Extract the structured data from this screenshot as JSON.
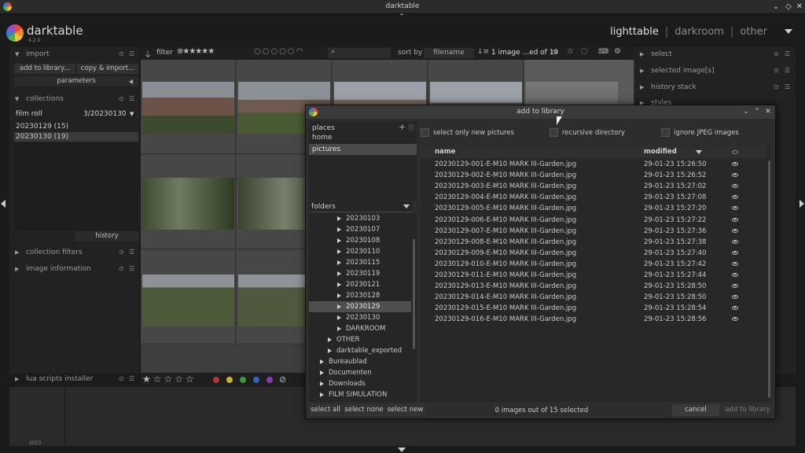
{
  "window": {
    "title": "darktable"
  },
  "header": {
    "app_name": "darktable",
    "version": "4.2.0",
    "views": [
      "lighttable",
      "darkroom",
      "other"
    ],
    "view_separator": "|"
  },
  "left_panel": {
    "import": {
      "label": "import",
      "add_button": "add to library...",
      "copy_button": "copy & import...",
      "parameters": "parameters"
    },
    "collections": {
      "label": "collections",
      "field": "film roll",
      "value": "3/20230130",
      "items": [
        "20230129 (15)",
        "20230130 (19)"
      ],
      "history": "history"
    },
    "collection_filters": "collection filters",
    "image_information": "image information",
    "lua_scripts": "lua scripts installer"
  },
  "filter_bar": {
    "filter_label": "filter",
    "sort_label": "sort by",
    "sort_value": "filename",
    "count_label": "1 image ...ed of 19"
  },
  "filmstrip": {
    "year": "2023"
  },
  "right_panel": {
    "sections": [
      "select",
      "selected image[s]",
      "history stack",
      "styles"
    ]
  },
  "dialog": {
    "title": "add to library",
    "places_label": "places",
    "places": [
      "home",
      "pictures"
    ],
    "folders_label": "folders",
    "folders": [
      {
        "name": "20230103",
        "level": 2,
        "expander": true
      },
      {
        "name": "20230107",
        "level": 2,
        "expander": true
      },
      {
        "name": "20230108",
        "level": 2,
        "expander": true
      },
      {
        "name": "20230110",
        "level": 2,
        "expander": true
      },
      {
        "name": "20230115",
        "level": 2,
        "expander": true
      },
      {
        "name": "20230119",
        "level": 2,
        "expander": true
      },
      {
        "name": "20230121",
        "level": 2,
        "expander": true
      },
      {
        "name": "20230128",
        "level": 2,
        "expander": true
      },
      {
        "name": "20230129",
        "level": 2,
        "expander": true,
        "selected": true
      },
      {
        "name": "20230130",
        "level": 2,
        "expander": true
      },
      {
        "name": "DARKROOM",
        "level": 2,
        "expander": true
      },
      {
        "name": "OTHER",
        "level": 1,
        "expander": true
      },
      {
        "name": "darktable_exported",
        "level": 1,
        "expander": true
      },
      {
        "name": "Bureaublad",
        "level": 0,
        "expander": true
      },
      {
        "name": "Documenten",
        "level": 0,
        "expander": true
      },
      {
        "name": "Downloads",
        "level": 0,
        "expander": true
      },
      {
        "name": "FILM SIMULATION",
        "level": 0,
        "expander": true
      }
    ],
    "options": {
      "only_new": "select only new pictures",
      "recursive": "recursive directory",
      "ignore_jpeg": "ignore JPEG images"
    },
    "columns": {
      "name": "name",
      "modified": "modified"
    },
    "files": [
      {
        "name": "20230129-001-E-M10 MARK III-Garden.jpg",
        "modified": "29-01-23 15:26:50"
      },
      {
        "name": "20230129-002-E-M10 MARK III-Garden.jpg",
        "modified": "29-01-23 15:26:52"
      },
      {
        "name": "20230129-003-E-M10 MARK III-Garden.jpg",
        "modified": "29-01-23 15:27:02"
      },
      {
        "name": "20230129-004-E-M10 MARK III-Garden.jpg",
        "modified": "29-01-23 15:27:08"
      },
      {
        "name": "20230129-005-E-M10 MARK III-Garden.jpg",
        "modified": "29-01-23 15:27:20"
      },
      {
        "name": "20230129-006-E-M10 MARK III-Garden.jpg",
        "modified": "29-01-23 15:27:22"
      },
      {
        "name": "20230129-007-E-M10 MARK III-Garden.jpg",
        "modified": "29-01-23 15:27:36"
      },
      {
        "name": "20230129-008-E-M10 MARK III-Garden.jpg",
        "modified": "29-01-23 15:27:38"
      },
      {
        "name": "20230129-009-E-M10 MARK III-Garden.jpg",
        "modified": "29-01-23 15:27:40"
      },
      {
        "name": "20230129-010-E-M10 MARK III-Garden.jpg",
        "modified": "29-01-23 15:27:42"
      },
      {
        "name": "20230129-011-E-M10 MARK III-Garden.jpg",
        "modified": "29-01-23 15:27:44"
      },
      {
        "name": "20230129-013-E-M10 MARK III-Garden.jpg",
        "modified": "29-01-23 15:28:50"
      },
      {
        "name": "20230129-014-E-M10 MARK III-Garden.jpg",
        "modified": "29-01-23 15:28:50"
      },
      {
        "name": "20230129-015-E-M10 MARK III-Garden.jpg",
        "modified": "29-01-23 15:28:54"
      },
      {
        "name": "20230129-016-E-M10 MARK III-Garden.jpg",
        "modified": "29-01-23 15:28:56"
      }
    ],
    "buttons": {
      "select_all": "select all",
      "select_none": "select none",
      "select_new": "select new",
      "cancel": "cancel",
      "add": "add to library"
    },
    "status": "0 images out of 15 selected"
  }
}
